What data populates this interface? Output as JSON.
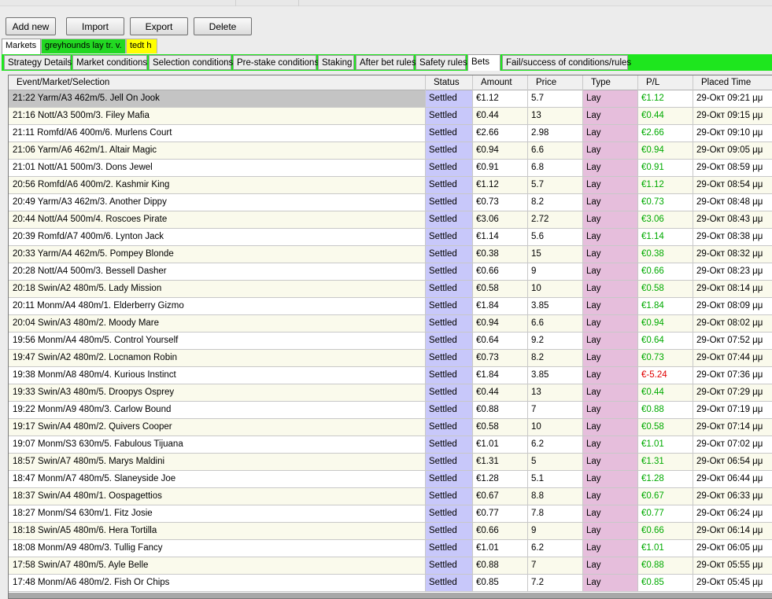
{
  "toolbar": {
    "buttons": [
      "Add new",
      "Import",
      "Export",
      "Delete"
    ]
  },
  "market_tabs": [
    {
      "label": "Markets",
      "color": "#ffffff"
    },
    {
      "label": "greyhounds lay tr. v.",
      "color": "#22d822"
    },
    {
      "label": "tedt h",
      "color": "#ffff00"
    }
  ],
  "strategy_tabs": [
    "Strategy Details",
    "Market conditions",
    "Selection conditions",
    "Pre-stake conditions",
    "Staking",
    "After bet rules",
    "Safety rules",
    "Bets",
    "Fail/success of conditions/rules"
  ],
  "active_strategy_tab": "Bets",
  "colors": {
    "tab_bar_green": "#1ee61e",
    "status_col_bg": "#c8c8fa",
    "type_col_bg": "#e6bedc",
    "profit_green": "#00aa00",
    "loss_red": "#e00000",
    "row_alt_bg": "#fafaec"
  },
  "bets_table": {
    "columns": [
      "Event/Market/Selection",
      "Status",
      "Amount",
      "Price",
      "Type",
      "P/L",
      "Placed Time"
    ],
    "rows": [
      [
        "21:22 Yarm/A3 462m/5. Jell On Jook",
        "Settled",
        "€1.12",
        "5.7",
        "Lay",
        "€1.12",
        "29-Окт 09:21 μμ"
      ],
      [
        "21:16 Nott/A3 500m/3. Filey Mafia",
        "Settled",
        "€0.44",
        "13",
        "Lay",
        "€0.44",
        "29-Окт 09:15 μμ"
      ],
      [
        "21:11 Romfd/A6 400m/6. Murlens Court",
        "Settled",
        "€2.66",
        "2.98",
        "Lay",
        "€2.66",
        "29-Окт 09:10 μμ"
      ],
      [
        "21:06 Yarm/A6 462m/1. Altair Magic",
        "Settled",
        "€0.94",
        "6.6",
        "Lay",
        "€0.94",
        "29-Окт 09:05 μμ"
      ],
      [
        "21:01 Nott/A1 500m/3. Dons Jewel",
        "Settled",
        "€0.91",
        "6.8",
        "Lay",
        "€0.91",
        "29-Окт 08:59 μμ"
      ],
      [
        "20:56 Romfd/A6 400m/2. Kashmir King",
        "Settled",
        "€1.12",
        "5.7",
        "Lay",
        "€1.12",
        "29-Окт 08:54 μμ"
      ],
      [
        "20:49 Yarm/A3 462m/3. Another Dippy",
        "Settled",
        "€0.73",
        "8.2",
        "Lay",
        "€0.73",
        "29-Окт 08:48 μμ"
      ],
      [
        "20:44 Nott/A4 500m/4. Roscoes Pirate",
        "Settled",
        "€3.06",
        "2.72",
        "Lay",
        "€3.06",
        "29-Окт 08:43 μμ"
      ],
      [
        "20:39 Romfd/A7 400m/6. Lynton Jack",
        "Settled",
        "€1.14",
        "5.6",
        "Lay",
        "€1.14",
        "29-Окт 08:38 μμ"
      ],
      [
        "20:33 Yarm/A4 462m/5. Pompey Blonde",
        "Settled",
        "€0.38",
        "15",
        "Lay",
        "€0.38",
        "29-Окт 08:32 μμ"
      ],
      [
        "20:28 Nott/A4 500m/3. Bessell Dasher",
        "Settled",
        "€0.66",
        "9",
        "Lay",
        "€0.66",
        "29-Окт 08:23 μμ"
      ],
      [
        "20:18 Swin/A2 480m/5. Lady Mission",
        "Settled",
        "€0.58",
        "10",
        "Lay",
        "€0.58",
        "29-Окт 08:14 μμ"
      ],
      [
        "20:11 Monm/A4 480m/1. Elderberry Gizmo",
        "Settled",
        "€1.84",
        "3.85",
        "Lay",
        "€1.84",
        "29-Окт 08:09 μμ"
      ],
      [
        "20:04 Swin/A3 480m/2. Moody Mare",
        "Settled",
        "€0.94",
        "6.6",
        "Lay",
        "€0.94",
        "29-Окт 08:02 μμ"
      ],
      [
        "19:56 Monm/A4 480m/5. Control Yourself",
        "Settled",
        "€0.64",
        "9.2",
        "Lay",
        "€0.64",
        "29-Окт 07:52 μμ"
      ],
      [
        "19:47 Swin/A2 480m/2. Locnamon Robin",
        "Settled",
        "€0.73",
        "8.2",
        "Lay",
        "€0.73",
        "29-Окт 07:44 μμ"
      ],
      [
        "19:38 Monm/A8 480m/4. Kurious Instinct",
        "Settled",
        "€1.84",
        "3.85",
        "Lay",
        "€-5.24",
        "29-Окт 07:36 μμ"
      ],
      [
        "19:33 Swin/A3 480m/5. Droopys Osprey",
        "Settled",
        "€0.44",
        "13",
        "Lay",
        "€0.44",
        "29-Окт 07:29 μμ"
      ],
      [
        "19:22 Monm/A9 480m/3. Carlow Bound",
        "Settled",
        "€0.88",
        "7",
        "Lay",
        "€0.88",
        "29-Окт 07:19 μμ"
      ],
      [
        "19:17 Swin/A4 480m/2. Quivers Cooper",
        "Settled",
        "€0.58",
        "10",
        "Lay",
        "€0.58",
        "29-Окт 07:14 μμ"
      ],
      [
        "19:07 Monm/S3 630m/5. Fabulous Tijuana",
        "Settled",
        "€1.01",
        "6.2",
        "Lay",
        "€1.01",
        "29-Окт 07:02 μμ"
      ],
      [
        "18:57 Swin/A7 480m/5. Marys Maldini",
        "Settled",
        "€1.31",
        "5",
        "Lay",
        "€1.31",
        "29-Окт 06:54 μμ"
      ],
      [
        "18:47 Monm/A7 480m/5. Slaneyside Joe",
        "Settled",
        "€1.28",
        "5.1",
        "Lay",
        "€1.28",
        "29-Окт 06:44 μμ"
      ],
      [
        "18:37 Swin/A4 480m/1. Oospagettios",
        "Settled",
        "€0.67",
        "8.8",
        "Lay",
        "€0.67",
        "29-Окт 06:33 μμ"
      ],
      [
        "18:27 Monm/S4 630m/1. Fitz Josie",
        "Settled",
        "€0.77",
        "7.8",
        "Lay",
        "€0.77",
        "29-Окт 06:24 μμ"
      ],
      [
        "18:18 Swin/A5 480m/6. Hera Tortilla",
        "Settled",
        "€0.66",
        "9",
        "Lay",
        "€0.66",
        "29-Окт 06:14 μμ"
      ],
      [
        "18:08 Monm/A9 480m/3. Tullig Fancy",
        "Settled",
        "€1.01",
        "6.2",
        "Lay",
        "€1.01",
        "29-Окт 06:05 μμ"
      ],
      [
        "17:58 Swin/A7 480m/5. Ayle Belle",
        "Settled",
        "€0.88",
        "7",
        "Lay",
        "€0.88",
        "29-Окт 05:55 μμ"
      ],
      [
        "17:48 Monm/A6 480m/2. Fish Or Chips",
        "Settled",
        "€0.85",
        "7.2",
        "Lay",
        "€0.85",
        "29-Окт 05:45 μμ"
      ]
    ]
  }
}
